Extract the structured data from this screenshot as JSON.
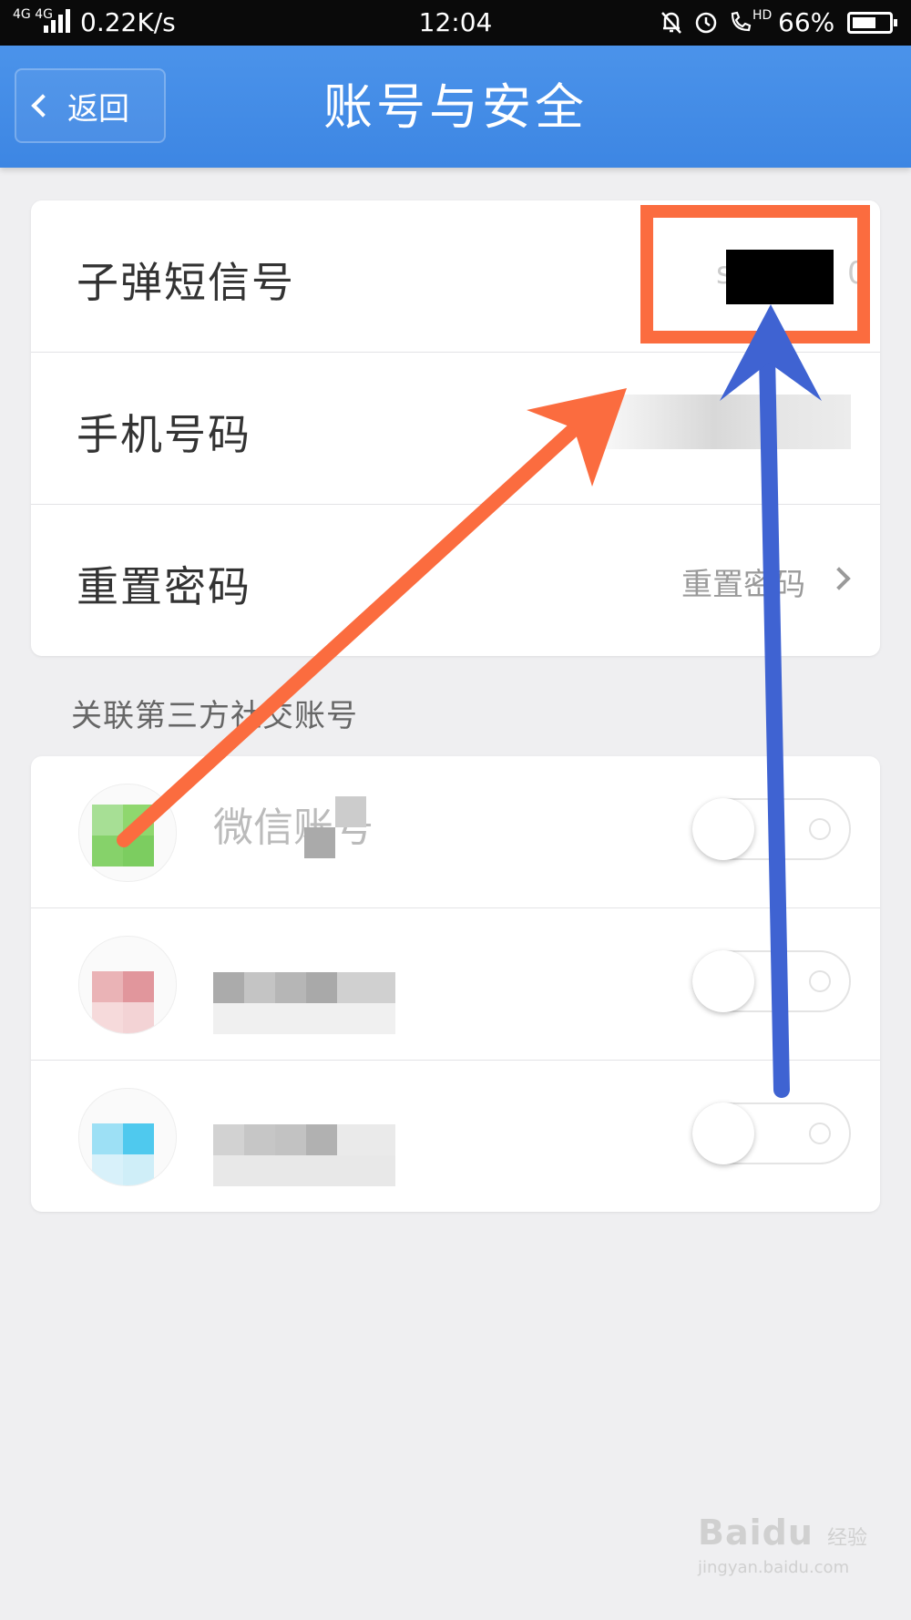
{
  "status_bar": {
    "network": "4G 4G",
    "speed": "0.22K/s",
    "time": "12:04",
    "hd": "HD",
    "battery_text": "66%",
    "battery_level": 0.66,
    "icons": [
      "silent-bell-icon",
      "alarm-icon",
      "hd-call-icon"
    ]
  },
  "header": {
    "back_label": "返回",
    "title": "账号与安全"
  },
  "account": {
    "bullet_id_label": "子弹短信号",
    "bullet_id_value_visible": "s",
    "bullet_id_value_end": "0",
    "phone_label": "手机号码",
    "reset_label": "重置密码",
    "reset_value": "重置密码"
  },
  "social": {
    "section_label": "关联第三方社交账号",
    "items": [
      {
        "name": "微信账号",
        "enabled": false,
        "icon": "wechat-icon",
        "color": "#7ed06a"
      },
      {
        "name": "",
        "enabled": false,
        "icon": "weibo-icon",
        "color": "#e07f86"
      },
      {
        "name": "",
        "enabled": false,
        "icon": "qq-icon",
        "color": "#4fc9ee"
      }
    ]
  },
  "annotations": {
    "highlight_color": "#fb6c3f",
    "arrow_orange": "#fb6c3f",
    "arrow_blue": "#3f63d2"
  },
  "watermark": {
    "brand": "Baidu",
    "sub": "经验",
    "url": "jingyan.baidu.com"
  }
}
